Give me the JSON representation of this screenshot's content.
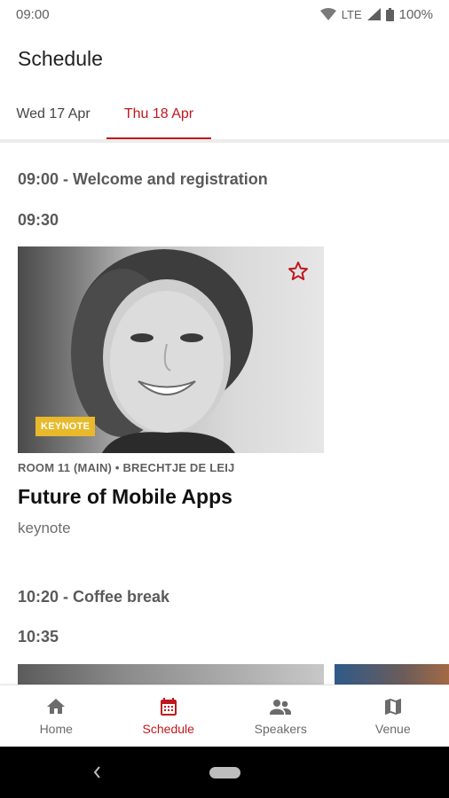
{
  "status_bar": {
    "time": "09:00",
    "network": "LTE",
    "battery": "100%"
  },
  "app_bar": {
    "title": "Schedule"
  },
  "tabs": [
    {
      "label": "Wed 17 Apr",
      "active": false
    },
    {
      "label": "Thu 18 Apr",
      "active": true
    }
  ],
  "schedule": {
    "slot1": "09:00 - Welcome and registration",
    "slot2": "09:30",
    "session": {
      "badge": "KEYNOTE",
      "meta": "ROOM 11 (MAIN) • BRECHTJE DE LEIJ",
      "title": "Future of Mobile Apps",
      "tag": "keynote",
      "favorite": false
    },
    "slot3": "10:20 - Coffee break",
    "slot4": "10:35"
  },
  "bottom_nav": [
    {
      "label": "Home",
      "icon": "home-icon",
      "active": false
    },
    {
      "label": "Schedule",
      "icon": "calendar-icon",
      "active": true
    },
    {
      "label": "Speakers",
      "icon": "people-icon",
      "active": false
    },
    {
      "label": "Venue",
      "icon": "map-icon",
      "active": false
    }
  ],
  "colors": {
    "accent": "#c0171d",
    "badge": "#e8b92b"
  }
}
